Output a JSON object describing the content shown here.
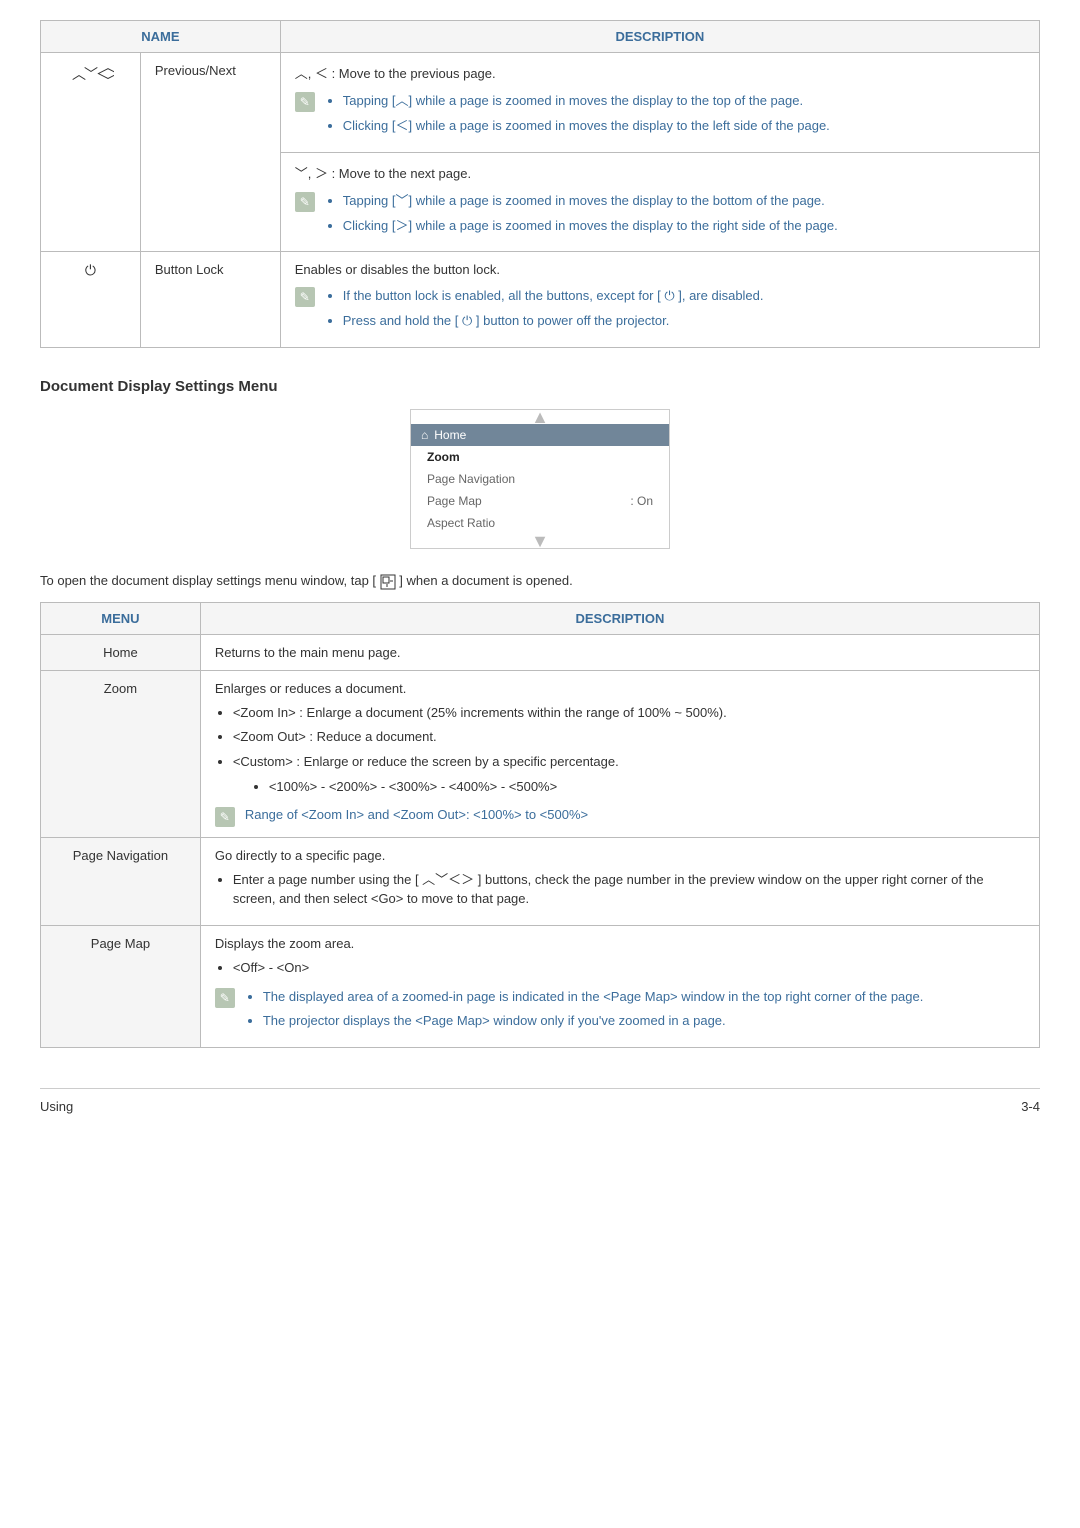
{
  "table1": {
    "headers": {
      "name": "NAME",
      "desc": "DESCRIPTION"
    },
    "rows": {
      "prev_next": {
        "label": "Previous/Next",
        "prev_title": "︿, ＜ : Move to the previous page.",
        "prev_notes": {
          "a": "Tapping [︿] while a page is zoomed in moves the display to the top of the page.",
          "b": "Clicking [＜] while a page is zoomed in moves the display to the left side of the page."
        },
        "next_title": "﹀, ＞ : Move to the next page.",
        "next_notes": {
          "a": "Tapping [﹀] while a page is zoomed in moves the display to the bottom of the page.",
          "b": "Clicking [＞] while a page is zoomed in moves the display to the right side of the page."
        }
      },
      "button_lock": {
        "label": "Button Lock",
        "title": "Enables or disables the button lock.",
        "notes": {
          "a": "If the button lock is enabled, all the buttons, except for [ ⏻ ], are disabled.",
          "b": "Press and hold the [ ⏻ ] button to power off the projector."
        }
      }
    }
  },
  "section_title": "Document Display Settings Menu",
  "menu_shot": {
    "home": "Home",
    "zoom": "Zoom",
    "page_nav": "Page Navigation",
    "page_map": "Page Map",
    "page_map_value": ": On",
    "aspect": "Aspect Ratio"
  },
  "tap_text_before": "To open the document display settings menu window, tap [",
  "tap_text_after": "] when a document is opened.",
  "table2": {
    "headers": {
      "menu": "MENU",
      "desc": "DESCRIPTION"
    },
    "rows": {
      "home": {
        "label": "Home",
        "text": "Returns to the main menu page."
      },
      "zoom": {
        "label": "Zoom",
        "title": "Enlarges or reduces a document.",
        "items": {
          "a": "<Zoom In> : Enlarge a document (25% increments within the range of 100% ~ 500%).",
          "b": "<Zoom Out> : Reduce a document.",
          "c": "<Custom> : Enlarge or reduce the screen by a specific percentage.",
          "c_sub": "<100%> - <200%> - <300%> - <400%> - <500%>"
        },
        "note": "Range of <Zoom In> and <Zoom Out>: <100%> to <500%>"
      },
      "page_nav": {
        "label": "Page Navigation",
        "title": "Go directly to a specific page.",
        "item": "Enter a page number using the [ ︿﹀＜＞ ] buttons, check the page number in the preview window on the upper right corner of the screen, and then select <Go> to move to that page."
      },
      "page_map": {
        "label": "Page Map",
        "title": "Displays the zoom area.",
        "sub": "<Off> - <On>",
        "notes": {
          "a": "The displayed area of a zoomed-in page is indicated in the <Page Map> window in the top right corner of the page.",
          "b": "The projector displays the <Page Map> window only if you've zoomed in a page."
        }
      }
    }
  },
  "footer": {
    "left": "Using",
    "right": "3-4"
  }
}
